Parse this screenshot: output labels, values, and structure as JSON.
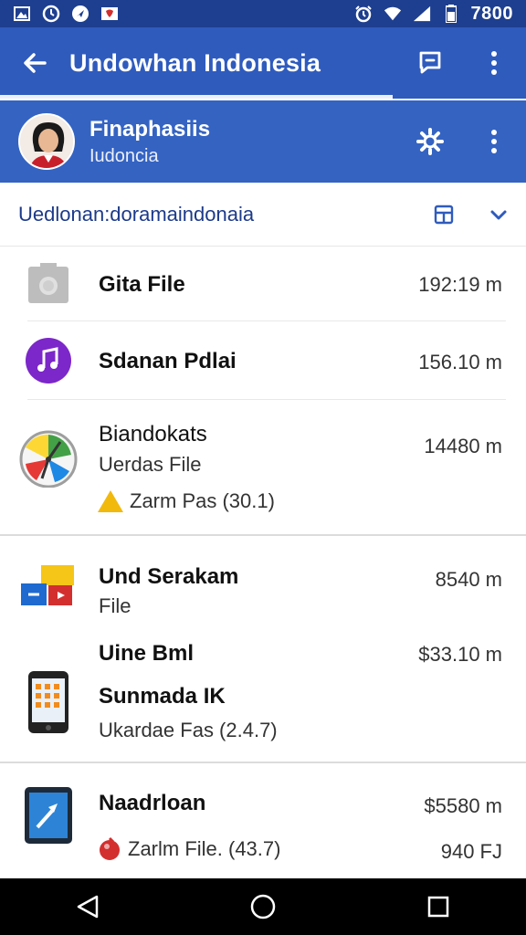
{
  "status_bar": {
    "time": "7800",
    "left_icons": [
      "gallery-icon",
      "clock-icon",
      "navigation-icon",
      "gmail-icon"
    ],
    "right_icons": [
      "alarm-icon",
      "wifi-icon",
      "signal-icon",
      "battery-icon"
    ]
  },
  "app_bar": {
    "title": "Undowhan Indonesia",
    "back_icon": "arrow-back-icon",
    "actions": [
      "comment-icon",
      "more-vert-icon"
    ]
  },
  "account": {
    "name": "Finaphasiis",
    "subtitle": "Iudoncia",
    "actions": [
      "settings-icon",
      "more-vert-icon"
    ]
  },
  "folder": {
    "path": "Uedlonan:doramaindonaia",
    "actions": [
      "grid-view-icon",
      "chevron-down-icon"
    ]
  },
  "files": [
    {
      "name": "Gita File",
      "size": "192:19 m",
      "icon": "camera-icon"
    },
    {
      "name": "Sdanan Pdlai",
      "size": "156.10 m",
      "icon": "music-icon"
    },
    {
      "name": "Biandokats",
      "sub": "Uerdas File",
      "meta": "Zarm Pas (30.1)",
      "size": "14480 m",
      "icon": "clock-app-icon",
      "meta_icon": "warning-icon"
    },
    {
      "name": "Und Serakam",
      "sub": "File",
      "size": "8540 m",
      "icon": "slides-icon"
    },
    {
      "name": "Uine Bml",
      "size": "$33.10 m"
    },
    {
      "name": "Sunmada IK",
      "sub": "Ukardae Fas (2.4.7)",
      "icon": "phone-icon"
    },
    {
      "name": "Naadrloan",
      "size": "$5580 m",
      "meta": "Zarlm File. (43.7)",
      "size2": "940 FJ",
      "icon": "tablet-icon",
      "meta_icon": "record-icon"
    }
  ],
  "nav": [
    "back-triangle-icon",
    "home-circle-icon",
    "recents-square-icon"
  ],
  "colors": {
    "status_bar": "#1e3f8f",
    "app_bar": "#2f5bbd",
    "account_band": "#3463c2",
    "path_text": "#1d3a8a"
  }
}
